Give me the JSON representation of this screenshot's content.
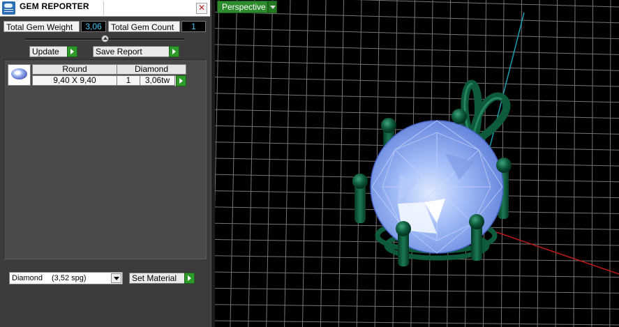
{
  "window": {
    "title": "GEM REPORTER",
    "close_glyph": "✕"
  },
  "summary": {
    "weight_label": "Total Gem Weight",
    "weight_value": "3,06",
    "count_label": "Total Gem Count",
    "count_value": "1"
  },
  "slider": {
    "position": 0.5
  },
  "toolbar": {
    "update_label": "Update",
    "save_label": "Save Report"
  },
  "gems": [
    {
      "icon": "round-gem-thumbnail",
      "shape": "Round",
      "material": "Diamond",
      "size": "9,40 X 9,40",
      "count": "1",
      "weight": "3,06tw"
    }
  ],
  "material": {
    "name": "Diamond",
    "sg": "(3,52 spg)",
    "set_label": "Set Material"
  },
  "viewport": {
    "view_label": "Perspective",
    "colors": {
      "grid": "#8a8a8a",
      "y_axis": "#1aa0b0",
      "x_axis": "#c01818",
      "metal": "#0d5a3c",
      "gem": "#8fb0f5"
    }
  }
}
